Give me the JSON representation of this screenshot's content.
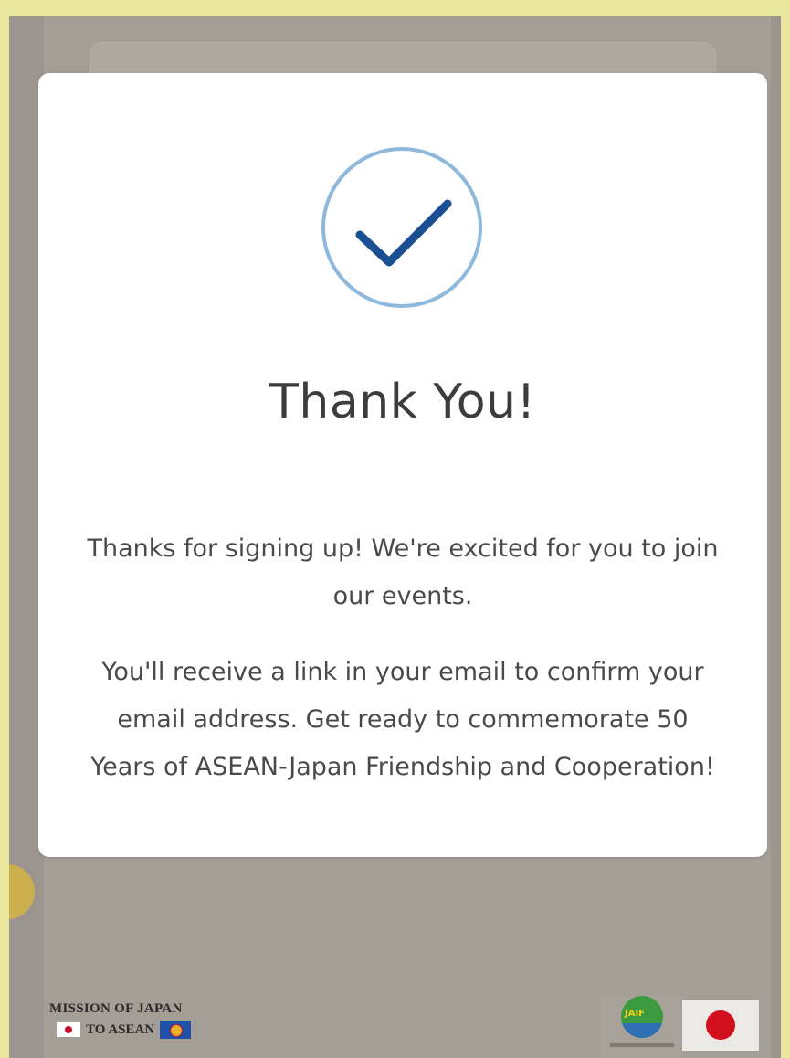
{
  "modal": {
    "title": "Thank You!",
    "message_1": "Thanks for signing up! We're excited for you to join our events.",
    "message_2": "You'll receive a link in your email to confirm your email address. Get ready to commemorate 50 Years of ASEAN-Japan Friendship and Cooperation!",
    "icon": "checkmark-circle-icon"
  },
  "footer": {
    "mission_line1": "MISSION OF JAPAN",
    "mission_line2": "TO ASEAN",
    "jaif_logo_text": "JAIF"
  },
  "colors": {
    "page_border": "#e8e59d",
    "overlay": "#9c958f",
    "modal_bg": "#ffffff",
    "check_ring": "#8fb9dc",
    "check_mark": "#1a4f93",
    "title_text": "#3c3c3c",
    "body_text": "#4a4a4a",
    "japan_red": "#d20f1c"
  }
}
